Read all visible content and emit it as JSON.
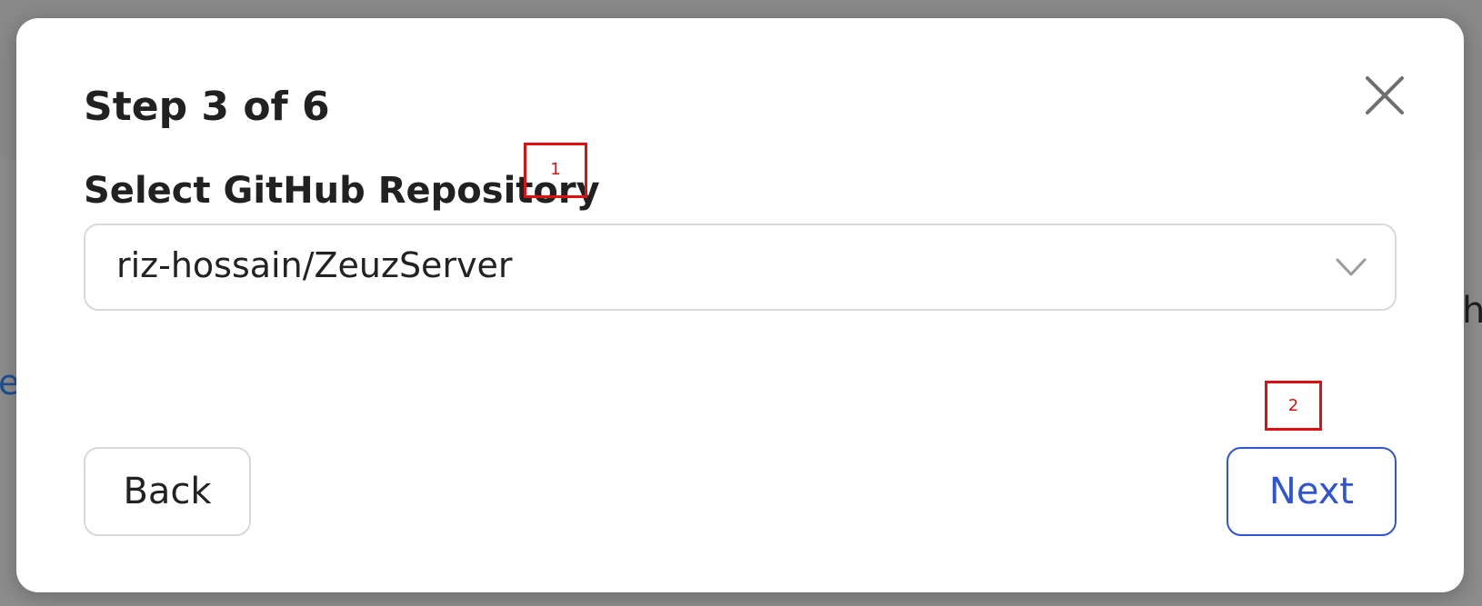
{
  "background": {
    "left_edge_fragment": "e",
    "right_edge_fragment": "h"
  },
  "dialog": {
    "title": "Step 3 of 6",
    "close_icon": "close-icon",
    "field": {
      "label": "Select GitHub Repository",
      "selected_value": "riz-hossain/ZeuzServer",
      "dropdown_icon": "chevron-down-icon"
    },
    "buttons": {
      "back_label": "Back",
      "next_label": "Next"
    }
  },
  "annotations": [
    {
      "number": "1"
    },
    {
      "number": "2"
    }
  ],
  "colors": {
    "overlay": "#8a8a8a",
    "modal_background": "#ffffff",
    "text_primary": "#212121",
    "border_neutral": "#d9d9d9",
    "accent_blue": "#2f54d4",
    "annotation_red": "#e01010"
  }
}
